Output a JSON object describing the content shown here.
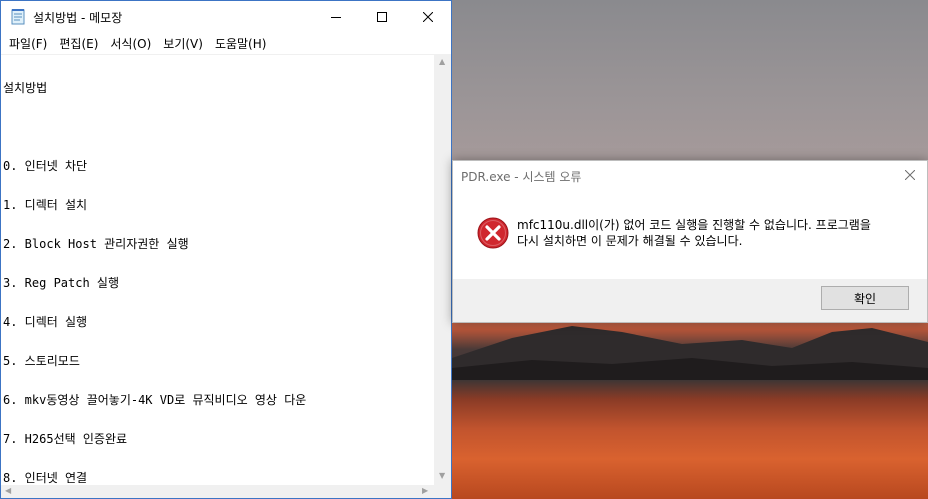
{
  "notepad": {
    "title": "설치방법 - 메모장",
    "icon": "notepad-icon",
    "menu": [
      "파일(F)",
      "편집(E)",
      "서식(O)",
      "보기(V)",
      "도움말(H)"
    ],
    "lines": [
      "설치방법",
      "",
      "0. 인터넷 차단",
      "1. 디렉터 설치",
      "2. Block Host 관리자권한 실행",
      "3. Reg Patch 실행",
      "4. 디렉터 실행",
      "5. 스토리모드",
      "6. mkv동영상 끌어놓기-4K VD로 뮤직비디오 영상 다운",
      "7. H265선택 인증완료",
      "8. 인터넷 연결"
    ]
  },
  "dialog": {
    "title": "PDR.exe - 시스템 오류",
    "icon": "error-icon",
    "message_line1": "mfc110u.dll이(가) 없어 코드 실행을 진행할 수 없습니다. 프로그램을",
    "message_line2": "다시 설치하면 이 문제가 해결될 수 있습니다.",
    "ok_label": "확인"
  },
  "colors": {
    "window_border": "#3c74c4",
    "error_red": "#d0272e",
    "dialog_footer": "#f0f0f0"
  }
}
